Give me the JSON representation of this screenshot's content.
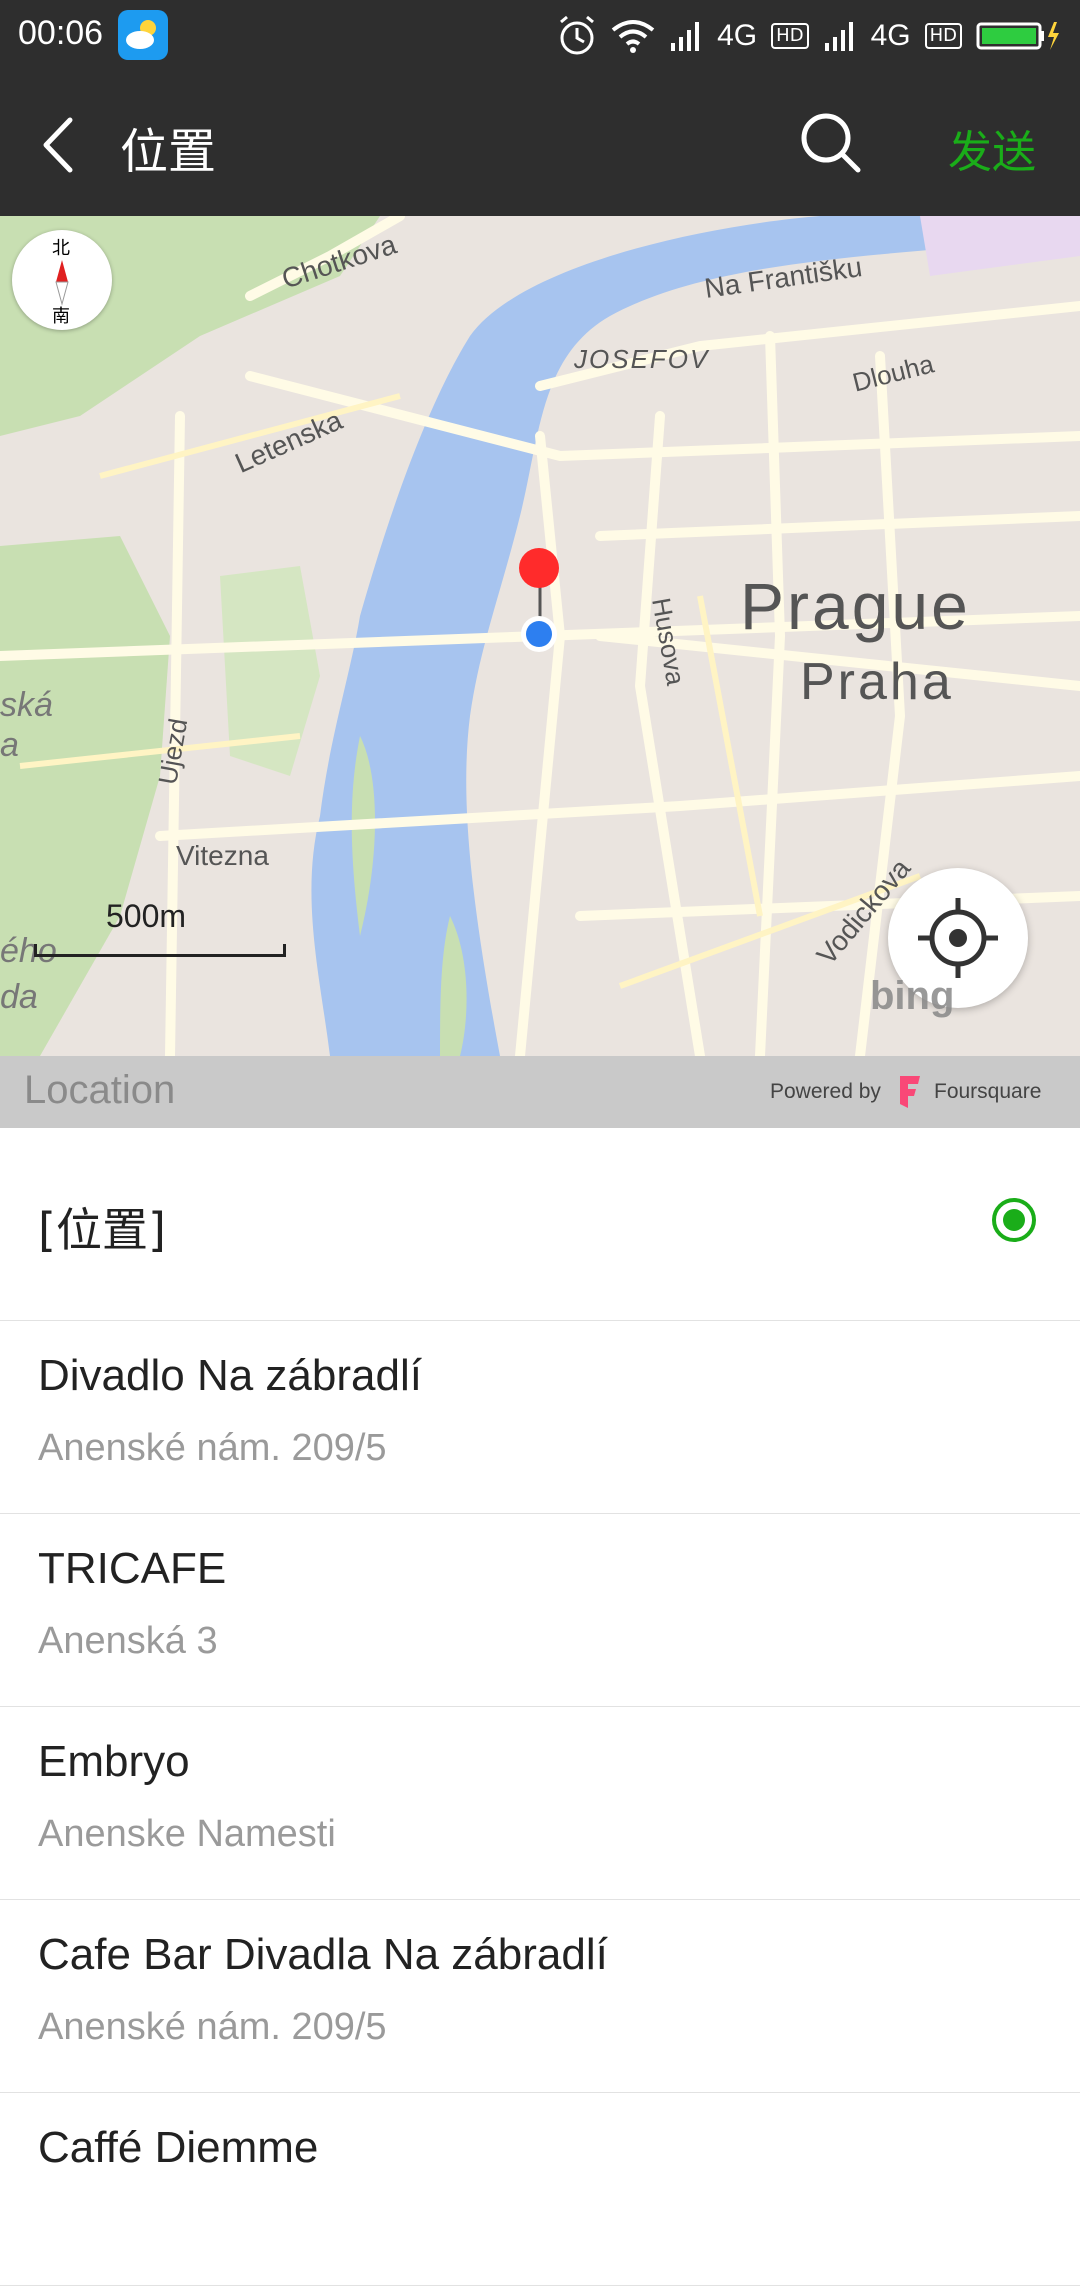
{
  "status_bar": {
    "time": "00:06",
    "net1": "4G",
    "hd1": "HD",
    "net2": "4G",
    "hd2": "HD",
    "icons": [
      "weather-icon",
      "alarm-icon",
      "wifi-icon",
      "signal-icon",
      "signal-icon",
      "battery-charging-icon"
    ]
  },
  "header": {
    "title": "位置",
    "send_label": "发送",
    "icons": [
      "back-icon",
      "search-icon"
    ]
  },
  "map": {
    "labels": {
      "chotkova": "Chotkova",
      "na_frantisku": "Na Františku",
      "josefov": "JOSEFOV",
      "dlouha": "Dlouha",
      "letenska": "Letenska",
      "husova": "Husova",
      "prague": "Prague",
      "praha": "Praha",
      "ujezd": "Ujezd",
      "vitezna": "Vitezna",
      "vodickova": "Vodickova",
      "ska": "ská",
      "a": "a",
      "eho": "ého",
      "da": "da"
    },
    "compass": {
      "north": "北",
      "south": "南"
    },
    "scale": "500m",
    "bing": "bing",
    "colors": {
      "water": "#a7c4ef",
      "land": "#eae4df",
      "park": "#c8dfb2",
      "road": "#fffbe6"
    }
  },
  "source": {
    "title": "Location",
    "powered_by": "Powered by",
    "provider": "Foursquare",
    "provider_color": "#f94877"
  },
  "current_location": {
    "label": "[位置]",
    "selected": true,
    "accent": "#1aad19"
  },
  "places": [
    {
      "name": "Divadlo Na zábradlí",
      "address": "Anenské nám. 209/5"
    },
    {
      "name": "TRICAFE",
      "address": "Anenská 3"
    },
    {
      "name": "Embryo",
      "address": "Anenske Namesti"
    },
    {
      "name": "Cafe Bar Divadla Na zábradlí",
      "address": "Anenské nám. 209/5"
    },
    {
      "name": "Caffé Diemme",
      "address": ""
    }
  ]
}
